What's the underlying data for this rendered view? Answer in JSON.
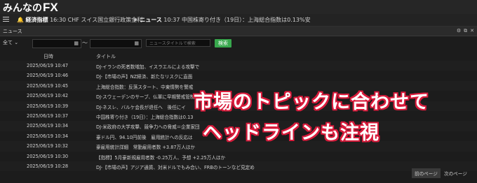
{
  "logo": {
    "text": "みんなの",
    "fx": "FX"
  },
  "navbar": {
    "item1_label": "経済指標",
    "item1_text": "16:30 CHF スイス国立銀行政策金利",
    "item2_label": "ニュース",
    "item2_text": "10:37 中国株寄り付き（19日）：上海総合指数は0.13%安"
  },
  "panel": {
    "title": "ニュース",
    "filter_select": "全て",
    "tilde": "～",
    "search_placeholder": "ニュースタイトルで検索",
    "search_button": "検索",
    "col_date": "日時",
    "col_title": "タイトル",
    "prev_page": "前のページ",
    "next_page": "次のページ"
  },
  "news": [
    {
      "date": "2025/06/19 10:47",
      "title": "DJ-イランの死者数増加、イスラエルによる攻撃で"
    },
    {
      "date": "2025/06/19 10:46",
      "title": "DJ-【市場の声】NZ経済、新たなリスクに直面"
    },
    {
      "date": "2025/06/19 10:45",
      "title": "上海総合指数：反落スタート、中東情勢を警戒"
    },
    {
      "date": "2025/06/19 10:42",
      "title": "DJ-スウェーデンのサーブ、仏軍に早期警戒管制機"
    },
    {
      "date": "2025/06/19 10:39",
      "title": "DJ-ネスレ、バルケ会長が退任へ　後任にイ"
    },
    {
      "date": "2025/06/19 10:37",
      "title": "中国株寄り付き（19日）：上海総合指数は0.13"
    },
    {
      "date": "2025/06/19 10:34",
      "title": "DJ-米政府の大学攻撃、競争力への脅威＝企業家団"
    },
    {
      "date": "2025/06/19 10:34",
      "title": "豪ドル円、94.10円前後　雇用統計への反応は"
    },
    {
      "date": "2025/06/19 10:32",
      "title": "豪雇用統計詳細　常勤雇用者数 +3.87万人ほか"
    },
    {
      "date": "2025/06/19 10:30",
      "title": "【指標】5月豪新規雇用者数 -0.25万人、予想 +2.25万人ほか"
    },
    {
      "date": "2025/06/19 10:28",
      "title": "DJ-【市場の声】アジア通貨、対米ドルでもみ合い、FRBのトーンなど見定め"
    }
  ],
  "overlay": {
    "line1": "市場のトピックに合わせて",
    "line2": "ヘッドラインも注視"
  },
  "colors": {
    "accent_green": "#38a84d",
    "overlay_outline": "#d81b3b"
  }
}
